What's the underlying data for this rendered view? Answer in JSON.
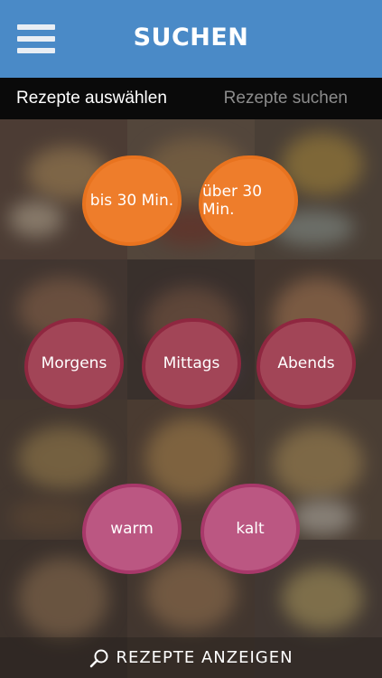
{
  "header": {
    "title": "Suchen",
    "menu_icon": "hamburger-menu-icon"
  },
  "tabs": [
    {
      "label": "Rezepte auswählen",
      "active": true
    },
    {
      "label": "Rezepte suchen",
      "active": false
    }
  ],
  "filters": {
    "duration": [
      "bis 30 Min.",
      "über 30 Min."
    ],
    "meal_time": [
      "Morgens",
      "Mittags",
      "Abends"
    ],
    "temperature": [
      "warm",
      "kalt"
    ]
  },
  "footer": {
    "icon": "search-icon",
    "label": "Rezepte anzeigen"
  },
  "colors": {
    "header_bg": "#4a8ac7",
    "tab_bar_bg": "#0a0a0a",
    "duration_button": "#ee7d2b",
    "meal_time_button": "#a24557",
    "temperature_button": "#bb5782"
  }
}
